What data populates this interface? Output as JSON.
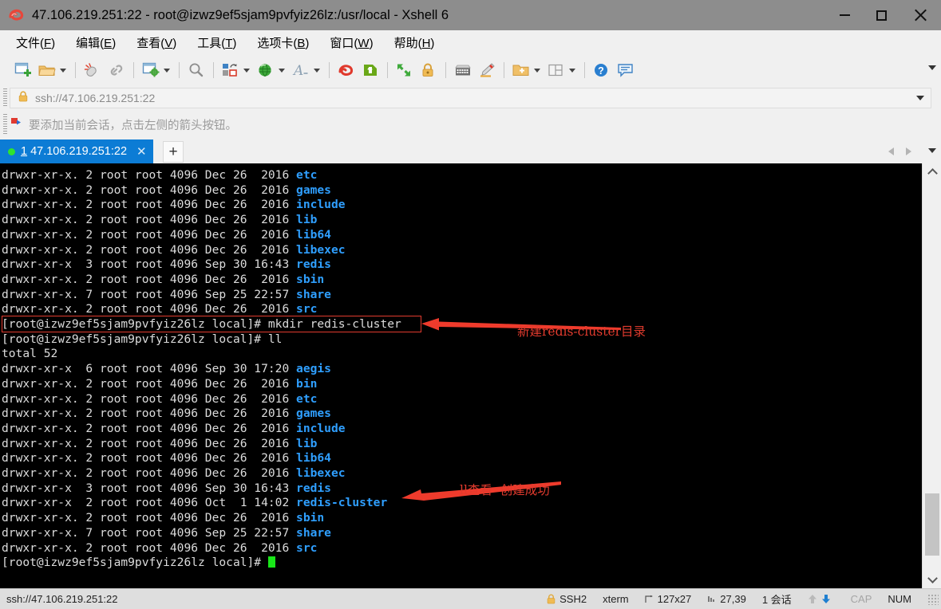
{
  "window": {
    "title": "47.106.219.251:22 - root@izwz9ef5sjam9pvfyiz26lz:/usr/local - Xshell 6",
    "app_icon": "xshell-icon",
    "minimize_label": "—",
    "maximize_label": "□",
    "close_label": "✕"
  },
  "menubar": {
    "items": [
      {
        "text": "文件",
        "key": "F"
      },
      {
        "text": "编辑",
        "key": "E"
      },
      {
        "text": "查看",
        "key": "V"
      },
      {
        "text": "工具",
        "key": "T"
      },
      {
        "text": "选项卡",
        "key": "B"
      },
      {
        "text": "窗口",
        "key": "W"
      },
      {
        "text": "帮助",
        "key": "H"
      }
    ]
  },
  "toolbar": {
    "buttons": [
      {
        "name": "new-session-icon",
        "has_caret": false
      },
      {
        "name": "open-folder-icon",
        "has_caret": true
      },
      {
        "sep": true
      },
      {
        "name": "disconnect-icon",
        "has_caret": false
      },
      {
        "name": "reconnect-link-icon",
        "has_caret": false
      },
      {
        "sep": true
      },
      {
        "name": "session-properties-icon",
        "has_caret": true
      },
      {
        "sep": true
      },
      {
        "name": "find-icon",
        "has_caret": false
      },
      {
        "sep": true
      },
      {
        "name": "layout-arrange-icon",
        "has_caret": true
      },
      {
        "name": "globe-encoding-icon",
        "has_caret": true
      },
      {
        "name": "font-icon",
        "has_caret": true
      },
      {
        "sep": true
      },
      {
        "name": "xftp-icon",
        "has_caret": false
      },
      {
        "name": "xagent-icon",
        "has_caret": false
      },
      {
        "sep": true
      },
      {
        "name": "fullscreen-icon",
        "has_caret": false
      },
      {
        "name": "lock-icon",
        "has_caret": false
      },
      {
        "sep": true
      },
      {
        "name": "keyboard-icon",
        "has_caret": false
      },
      {
        "name": "highlight-pen-icon",
        "has_caret": false
      },
      {
        "sep": true
      },
      {
        "name": "add-folder-icon",
        "has_caret": true
      },
      {
        "name": "split-view-icon",
        "has_caret": true
      },
      {
        "sep": true
      },
      {
        "name": "help-icon",
        "has_caret": false
      },
      {
        "name": "chat-icon",
        "has_caret": false
      }
    ],
    "overflow_icon": "chevron-down-icon"
  },
  "address_bar": {
    "lock_icon": "lock-icon",
    "value": "ssh://47.106.219.251:22",
    "dropdown_icon": "chevron-down-icon"
  },
  "notice": {
    "icon": "red-flag-icon",
    "text": "要添加当前会话，点击左侧的箭头按钮。"
  },
  "tabs": {
    "active": {
      "index": "1",
      "label": "47.106.219.251:22",
      "status_dot_color": "#2fe32f",
      "close_label": "✕"
    },
    "new_tab_label": "+",
    "nav_prev_icon": "chevron-left-icon",
    "nav_next_icon": "chevron-right-icon",
    "dropdown_icon": "chevron-down-icon"
  },
  "terminal": {
    "background": "#000000",
    "dir_color": "#2f9fff",
    "text_color": "#d6d6d6",
    "cursor_color": "#19e619",
    "lines": [
      {
        "perm": "drwxr-xr-x. 2 root root 4096 Dec 26  2016 ",
        "name": "etc"
      },
      {
        "perm": "drwxr-xr-x. 2 root root 4096 Dec 26  2016 ",
        "name": "games"
      },
      {
        "perm": "drwxr-xr-x. 2 root root 4096 Dec 26  2016 ",
        "name": "include"
      },
      {
        "perm": "drwxr-xr-x. 2 root root 4096 Dec 26  2016 ",
        "name": "lib"
      },
      {
        "perm": "drwxr-xr-x. 2 root root 4096 Dec 26  2016 ",
        "name": "lib64"
      },
      {
        "perm": "drwxr-xr-x. 2 root root 4096 Dec 26  2016 ",
        "name": "libexec"
      },
      {
        "perm": "drwxr-xr-x  3 root root 4096 Sep 30 16:43 ",
        "name": "redis"
      },
      {
        "perm": "drwxr-xr-x. 2 root root 4096 Dec 26  2016 ",
        "name": "sbin"
      },
      {
        "perm": "drwxr-xr-x. 7 root root 4096 Sep 25 22:57 ",
        "name": "share"
      },
      {
        "perm": "drwxr-xr-x. 2 root root 4096 Dec 26  2016 ",
        "name": "src"
      },
      {
        "perm": "[root@izwz9ef5sjam9pvfyiz26lz local]# mkdir redis-cluster",
        "name": ""
      },
      {
        "perm": "[root@izwz9ef5sjam9pvfyiz26lz local]# ll",
        "name": ""
      },
      {
        "perm": "total 52",
        "name": ""
      },
      {
        "perm": "drwxr-xr-x  6 root root 4096 Sep 30 17:20 ",
        "name": "aegis"
      },
      {
        "perm": "drwxr-xr-x. 2 root root 4096 Dec 26  2016 ",
        "name": "bin"
      },
      {
        "perm": "drwxr-xr-x. 2 root root 4096 Dec 26  2016 ",
        "name": "etc"
      },
      {
        "perm": "drwxr-xr-x. 2 root root 4096 Dec 26  2016 ",
        "name": "games"
      },
      {
        "perm": "drwxr-xr-x. 2 root root 4096 Dec 26  2016 ",
        "name": "include"
      },
      {
        "perm": "drwxr-xr-x. 2 root root 4096 Dec 26  2016 ",
        "name": "lib"
      },
      {
        "perm": "drwxr-xr-x. 2 root root 4096 Dec 26  2016 ",
        "name": "lib64"
      },
      {
        "perm": "drwxr-xr-x. 2 root root 4096 Dec 26  2016 ",
        "name": "libexec"
      },
      {
        "perm": "drwxr-xr-x  3 root root 4096 Sep 30 16:43 ",
        "name": "redis"
      },
      {
        "perm": "drwxr-xr-x  2 root root 4096 Oct  1 14:02 ",
        "name": "redis-cluster"
      },
      {
        "perm": "drwxr-xr-x. 2 root root 4096 Dec 26  2016 ",
        "name": "sbin"
      },
      {
        "perm": "drwxr-xr-x. 7 root root 4096 Sep 25 22:57 ",
        "name": "share"
      },
      {
        "perm": "drwxr-xr-x. 2 root root 4096 Dec 26  2016 ",
        "name": "src"
      },
      {
        "perm": "[root@izwz9ef5sjam9pvfyiz26lz local]# ",
        "name": "",
        "cursor": true
      }
    ],
    "annotations": [
      {
        "name": "annotation-mkdir",
        "text": "新建redis-cluster目录",
        "color": "#e23b2e"
      },
      {
        "name": "annotation-ll",
        "text": "ll查看  创建成功",
        "color": "#e23b2e"
      }
    ]
  },
  "scrollbar": {
    "up_icon": "chevron-up-icon",
    "down_icon": "chevron-down-icon"
  },
  "statusbar": {
    "connection": "ssh://47.106.219.251:22",
    "protocol": "SSH2",
    "terminal_type": "xterm",
    "size": "127x27",
    "cursor_position": "27,39",
    "sessions": "1 会话",
    "cap": "CAP",
    "num": "NUM",
    "lock_icon": "lock-icon",
    "upload_icon": "arrow-up-icon",
    "download_icon": "arrow-down-icon"
  }
}
